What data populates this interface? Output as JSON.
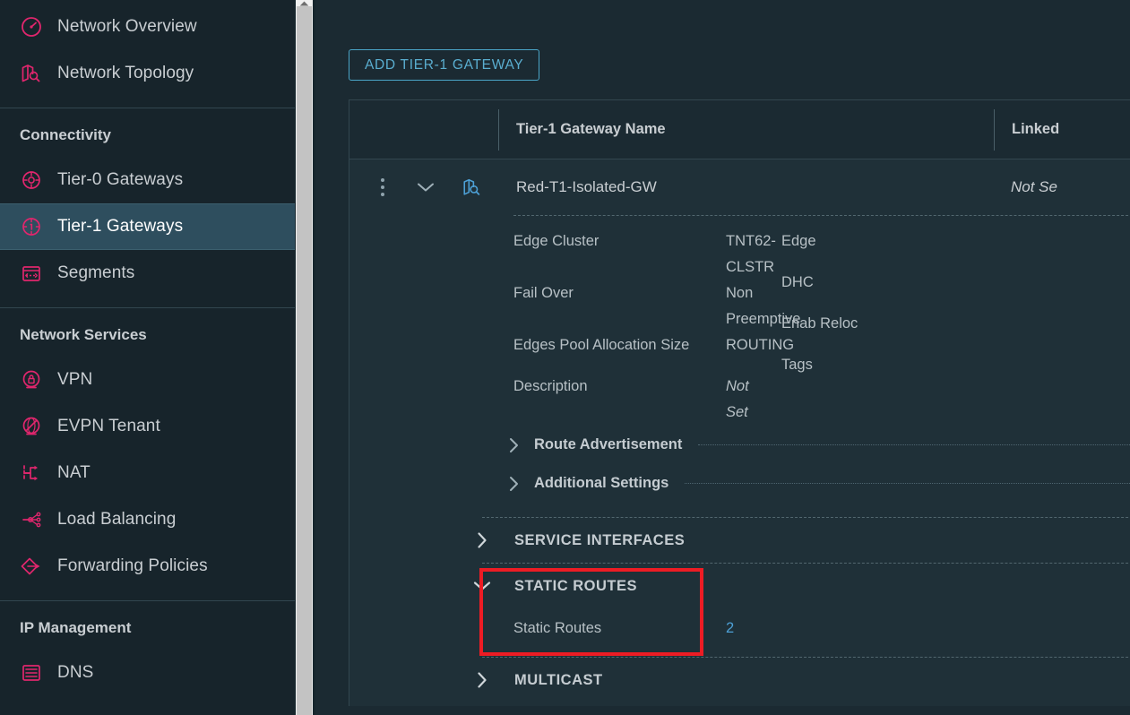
{
  "sidebar": {
    "groups": [
      {
        "title": null,
        "items": [
          {
            "label": "Network Overview",
            "icon": "gauge-icon",
            "selected": false
          },
          {
            "label": "Network Topology",
            "icon": "map-search-icon",
            "selected": false
          }
        ]
      },
      {
        "title": "Connectivity",
        "items": [
          {
            "label": "Tier-0 Gateways",
            "icon": "tier0-gateway-icon",
            "selected": false
          },
          {
            "label": "Tier-1 Gateways",
            "icon": "tier1-gateway-icon",
            "selected": true
          },
          {
            "label": "Segments",
            "icon": "segments-icon",
            "selected": false
          }
        ]
      },
      {
        "title": "Network Services",
        "items": [
          {
            "label": "VPN",
            "icon": "vpn-lock-icon",
            "selected": false
          },
          {
            "label": "EVPN Tenant",
            "icon": "evpn-tenant-icon",
            "selected": false
          },
          {
            "label": "NAT",
            "icon": "nat-arrow-icon",
            "selected": false
          },
          {
            "label": "Load Balancing",
            "icon": "load-balancing-icon",
            "selected": false
          },
          {
            "label": "Forwarding Policies",
            "icon": "forwarding-policies-icon",
            "selected": false
          }
        ]
      },
      {
        "title": "IP Management",
        "items": [
          {
            "label": "DNS",
            "icon": "dns-icon",
            "selected": false
          }
        ]
      }
    ]
  },
  "main": {
    "add_button": "ADD TIER-1 GATEWAY",
    "table": {
      "columns": {
        "name": "Tier-1 Gateway Name",
        "linked": "Linked"
      },
      "row": {
        "name": "Red-T1-Isolated-GW",
        "linked": "Not Se",
        "details_left": [
          {
            "label": "Edge Cluster",
            "value": "TNT62-CLSTR",
            "italic": false
          },
          {
            "label": "Fail Over",
            "value": "Non Preemptive",
            "italic": false
          },
          {
            "label": "Edges Pool Allocation Size",
            "value": "ROUTING",
            "italic": false
          },
          {
            "label": "Description",
            "value": "Not Set",
            "italic": true
          }
        ],
        "details_right": [
          {
            "label": "Edge",
            "value": ""
          },
          {
            "label": "DHC",
            "value": ""
          },
          {
            "label": "Enab Reloc",
            "value": ""
          },
          {
            "label": "Tags",
            "value": ""
          }
        ],
        "expanders": [
          {
            "label": "Route Advertisement",
            "expanded": false
          },
          {
            "label": "Additional Settings",
            "expanded": false
          }
        ],
        "sections": [
          {
            "label": "SERVICE INTERFACES",
            "expanded": false
          },
          {
            "label": "STATIC ROUTES",
            "expanded": true,
            "highlighted": true
          },
          {
            "label": "MULTICAST",
            "expanded": false
          }
        ],
        "static_routes": {
          "label": "Static Routes",
          "count": "2"
        }
      }
    }
  },
  "colors": {
    "accent_pink": "#e0266d",
    "link_blue": "#4da0d6",
    "button_blue": "#5aaed0",
    "annotation_red": "#ed1c24",
    "panel_bg": "#1b2a32",
    "row_bg": "#1f3038",
    "sidebar_bg": "#17242b",
    "selected_bg": "#2e4e5e"
  }
}
